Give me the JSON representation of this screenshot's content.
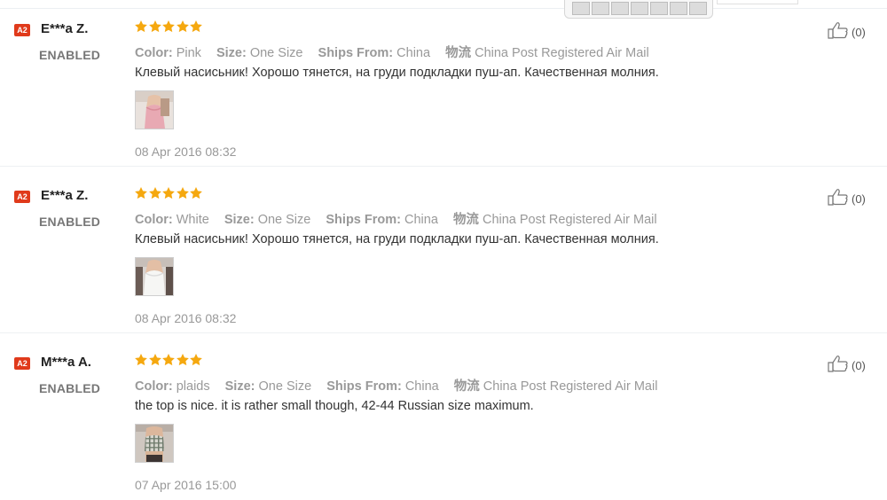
{
  "reviews": [
    {
      "badge": "A2",
      "user": "E***a Z.",
      "status": "ENABLED",
      "rating": 5,
      "attributes": {
        "color_key": "Color:",
        "color_value": "Pink",
        "size_key": "Size:",
        "size_value": "One Size",
        "ships_key": "Ships From:",
        "ships_value": "China",
        "logistics_key": "物流",
        "logistics_value": "China Post Registered Air Mail"
      },
      "text": "Клевый насисьник! Хорошо тянется, на груди подкладки пуш-ап. Качественная молния.",
      "photo": "pink-crop-top-photo",
      "date": "08 Apr 2016 08:32",
      "likes": "(0)"
    },
    {
      "badge": "A2",
      "user": "E***a Z.",
      "status": "ENABLED",
      "rating": 5,
      "attributes": {
        "color_key": "Color:",
        "color_value": "White",
        "size_key": "Size:",
        "size_value": "One Size",
        "ships_key": "Ships From:",
        "ships_value": "China",
        "logistics_key": "物流",
        "logistics_value": "China Post Registered Air Mail"
      },
      "text": "Клевый насисьник! Хорошо тянется, на груди подкладки пуш-ап. Качественная молния.",
      "photo": "white-crop-top-photo",
      "date": "08 Apr 2016 08:32",
      "likes": "(0)"
    },
    {
      "badge": "A2",
      "user": "M***a A.",
      "status": "ENABLED",
      "rating": 5,
      "attributes": {
        "color_key": "Color:",
        "color_value": "plaids",
        "size_key": "Size:",
        "size_value": "One Size",
        "ships_key": "Ships From:",
        "ships_value": "China",
        "logistics_key": "物流",
        "logistics_value": "China Post Registered Air Mail"
      },
      "text": "the top is nice. it is rather small though, 42-44 Russian size maximum.",
      "photo": "plaid-crop-top-photo",
      "date": "07 Apr 2016 15:00",
      "likes": "(0)"
    }
  ],
  "colors": {
    "star": "#f5a80f",
    "badge": "#e03a1b",
    "muted": "#999999",
    "text": "#333333"
  }
}
